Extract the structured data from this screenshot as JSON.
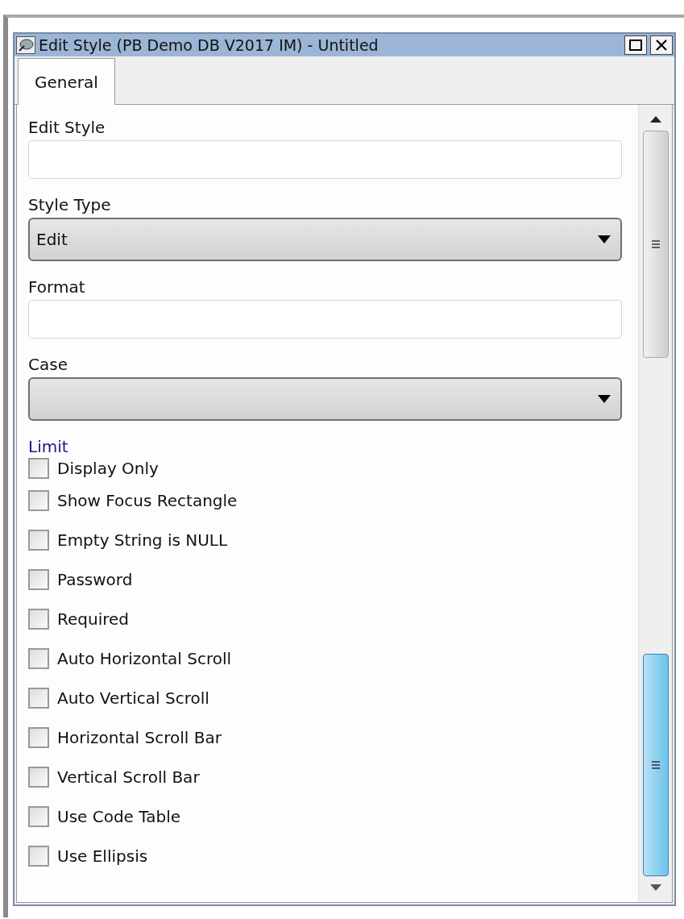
{
  "window": {
    "title": "Edit Style (PB Demo DB V2017 IM) - Untitled"
  },
  "tabs": [
    {
      "label": "General",
      "selected": true
    }
  ],
  "fields": [
    {
      "kind": "text",
      "label": "Edit Style"
    },
    {
      "kind": "select",
      "label": "Style Type",
      "value": "Edit"
    },
    {
      "kind": "text",
      "label": "Format"
    },
    {
      "kind": "select",
      "label": "Case"
    }
  ],
  "limit_label": "Limit",
  "checkboxes": [
    {
      "label": "Display Only",
      "checked": false
    },
    {
      "label": "Show Focus Rectangle",
      "checked": false
    },
    {
      "label": "Empty String is NULL",
      "checked": false
    },
    {
      "label": "Password",
      "checked": false
    },
    {
      "label": "Required",
      "checked": false
    },
    {
      "label": "Auto Horizontal Scroll",
      "checked": false
    },
    {
      "label": "Auto Vertical Scroll",
      "checked": false
    },
    {
      "label": "Horizontal Scroll Bar",
      "checked": false
    },
    {
      "label": "Vertical Scroll Bar",
      "checked": false
    },
    {
      "label": "Use Code Table",
      "checked": false
    },
    {
      "label": "Use Ellipsis",
      "checked": false
    }
  ]
}
